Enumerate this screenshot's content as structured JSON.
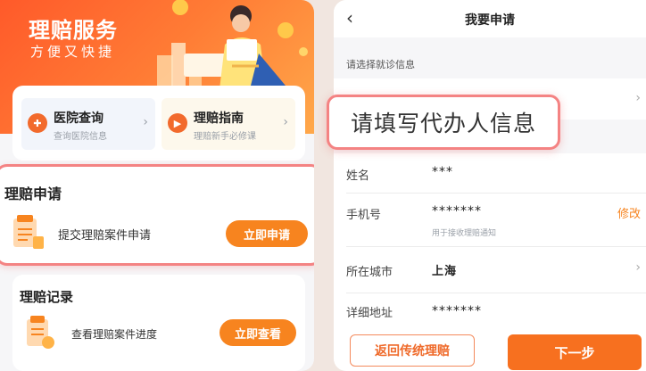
{
  "left": {
    "hero": {
      "title": "理赔服务",
      "subtitle": "方便又快捷"
    },
    "quick_links": [
      {
        "title": "医院查询",
        "subtitle": "查询医院信息",
        "icon": "hospital-icon"
      },
      {
        "title": "理赔指南",
        "subtitle": "理赔新手必修课",
        "icon": "guide-icon"
      }
    ],
    "apply": {
      "title": "理赔申请",
      "text": "提交理赔案件申请",
      "button": "立即申请"
    },
    "record": {
      "title": "理赔记录",
      "text": "查看理赔案件进度",
      "button": "立即查看"
    }
  },
  "right": {
    "nav": {
      "title": "我要申请"
    },
    "section_label": "请选择就诊信息",
    "popup": "请填写代办人信息",
    "form": {
      "name_label": "姓名",
      "name_value": "***",
      "phone_label": "手机号",
      "phone_value": "*******",
      "phone_hint": "用于接收理赔通知",
      "phone_edit": "修改",
      "city_label": "所在城市",
      "city_value": "上海",
      "address_label": "详细地址",
      "address_value": "*******"
    },
    "buttons": {
      "back": "返回传统理赔",
      "next": "下一步"
    }
  },
  "colors": {
    "accent": "#f7841f",
    "highlight_border": "#f48383",
    "hero_start": "#ff5a2a",
    "hero_end": "#ffa84a"
  }
}
